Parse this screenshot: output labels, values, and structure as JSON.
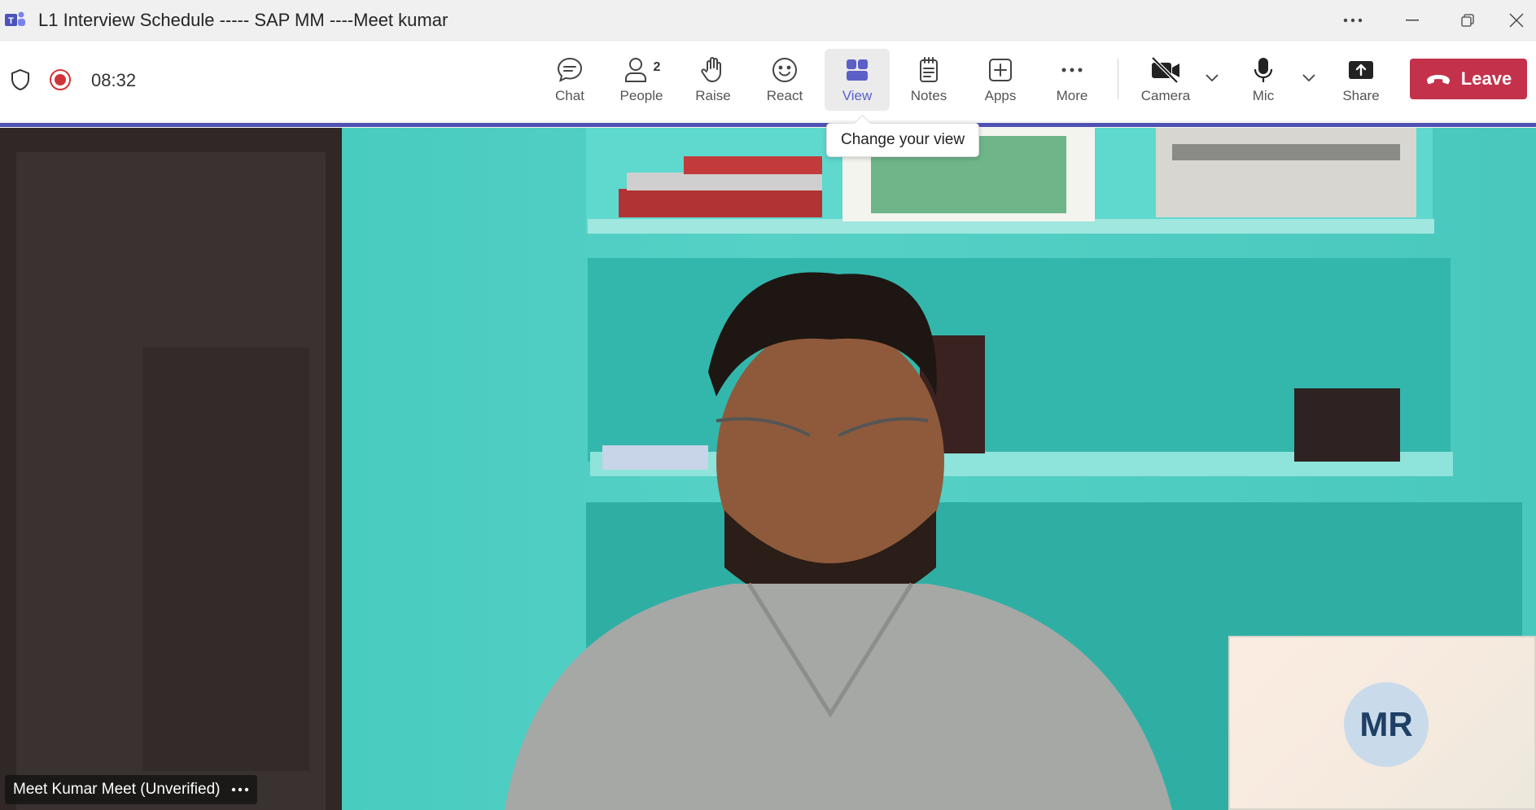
{
  "window": {
    "title": "L1 Interview Schedule ----- SAP MM ----Meet kumar",
    "app_icon": "teams-icon"
  },
  "meeting": {
    "timer": "08:32",
    "recording": true
  },
  "toolbar": {
    "buttons": [
      {
        "label": "Chat",
        "icon": "chat-icon"
      },
      {
        "label": "People",
        "icon": "people-icon",
        "badge": "2"
      },
      {
        "label": "Raise",
        "icon": "raise-hand-icon"
      },
      {
        "label": "React",
        "icon": "smiley-icon"
      },
      {
        "label": "View",
        "icon": "grid-view-icon",
        "active": true
      },
      {
        "label": "Notes",
        "icon": "notes-icon"
      },
      {
        "label": "Apps",
        "icon": "apps-icon"
      },
      {
        "label": "More",
        "icon": "more-icon"
      },
      {
        "label": "Camera",
        "icon": "camera-off-icon"
      },
      {
        "label": "Mic",
        "icon": "mic-icon"
      },
      {
        "label": "Share",
        "icon": "share-icon"
      }
    ],
    "leave_label": "Leave"
  },
  "tooltip": "Change your view",
  "participant": {
    "name": "Meet Kumar Meet (Unverified)"
  },
  "self_view": {
    "initials": "MR"
  },
  "colors": {
    "accent": "#5b5fc7",
    "leave": "#c4314b",
    "record": "#d13438"
  }
}
